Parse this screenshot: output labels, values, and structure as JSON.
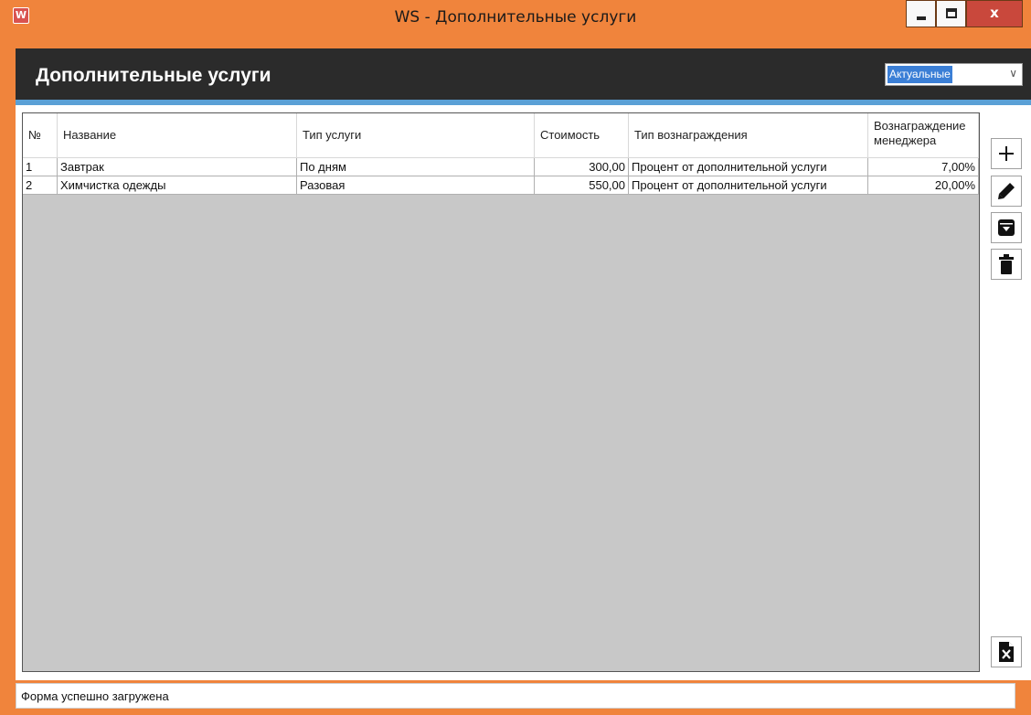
{
  "window": {
    "app_icon": "W",
    "title": "WS - Дополнительные услуги",
    "close_glyph": "x"
  },
  "header": {
    "title": "Дополнительные услуги",
    "filter": {
      "selected": "Актуальные"
    }
  },
  "table": {
    "columns": [
      "№",
      "Название",
      "Тип услуги",
      "Стоимость",
      "Тип вознаграждения",
      "Вознаграждение менеджера"
    ],
    "rows": [
      {
        "num": "1",
        "name": "Завтрак",
        "type": "По дням",
        "cost": "300,00",
        "reward_type": "Процент от дополнительной услуги",
        "reward": "7,00%"
      },
      {
        "num": "2",
        "name": "Химчистка одежды",
        "type": "Разовая",
        "cost": "550,00",
        "reward_type": "Процент от дополнительной услуги",
        "reward": "20,00%"
      }
    ]
  },
  "toolbar": {
    "icons": [
      "plus-icon",
      "pencil-icon",
      "archive-icon",
      "trash-icon",
      "excel-export-icon"
    ]
  },
  "status": {
    "text": "Форма успешно загружена"
  },
  "colors": {
    "titlebar": "#f0843c",
    "header": "#2b2b2b",
    "separator": "#5aa0d6",
    "grid_bg": "#c8c8c8",
    "close": "#c9483c"
  }
}
